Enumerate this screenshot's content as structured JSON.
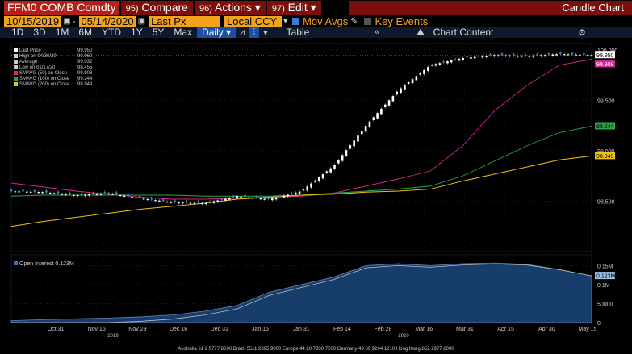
{
  "topbar": {
    "ticker": "FFM0 COMB Comdty",
    "compare_num": "95)",
    "compare": "Compare",
    "actions_num": "96)",
    "actions": "Actions ▾",
    "edit_num": "97)",
    "edit": "Edit ▾",
    "title": "Candle Chart"
  },
  "controls": {
    "start_date": "10/15/2019",
    "end_date": "05/14/2020",
    "field": "Last Px",
    "currency": "Local CCY",
    "mov_avgs": "Mov Avgs",
    "key_events": "Key Events"
  },
  "toolbar": {
    "periods": [
      "1D",
      "3D",
      "1M",
      "6M",
      "YTD",
      "1Y",
      "5Y",
      "Max"
    ],
    "frequency": "Daily ▾",
    "table": "Table",
    "chart_content": "Chart Content"
  },
  "legend": [
    {
      "label": "Last Price",
      "value": "99.950",
      "color": "#ffffff"
    },
    {
      "label": "High on 04/30/20",
      "value": "99.960",
      "color": "#cccccc"
    },
    {
      "label": "Average",
      "value": "99.032",
      "color": "#cccccc"
    },
    {
      "label": "Low on 01/17/20",
      "value": "98.455",
      "color": "#cccccc"
    },
    {
      "label": "SMAVG (50)  on Close",
      "value": "99.908",
      "color": "#d3248f"
    },
    {
      "label": "SMAVG (100)  on Close",
      "value": "99.244",
      "color": "#27a844"
    },
    {
      "label": "SMAVG (200)  on Close",
      "value": "98.949",
      "color": "#f1c40f"
    }
  ],
  "oi_legend": "Open Interest  0.123M",
  "price_axis": {
    "ticks": [
      "100.000",
      "99.500",
      "99.000",
      "98.500"
    ],
    "labels": [
      {
        "text": "99.950",
        "bg": "#ffffff",
        "fg": "#000000"
      },
      {
        "text": "99.908",
        "bg": "#d3248f",
        "fg": "#ffffff"
      },
      {
        "text": "99.244",
        "bg": "#27a844",
        "fg": "#000000"
      },
      {
        "text": "98.949",
        "bg": "#f1c40f",
        "fg": "#000000"
      }
    ]
  },
  "oi_axis": {
    "ticks": [
      "0.15M",
      "0.1M",
      "50000",
      "0"
    ],
    "label": "0.123M"
  },
  "x_axis": {
    "ticks": [
      "Oct 31",
      "Nov 15",
      "Nov 29",
      "Dec 16",
      "Dec 31",
      "Jan 15",
      "Jan 31",
      "Feb 14",
      "Feb 28",
      "Mar 16",
      "Mar 31",
      "Apr 15",
      "Apr 30",
      "May 15"
    ],
    "years": [
      "2019",
      "2020"
    ]
  },
  "footer": "Australia 61 2 9777 8600  Brazil 5511 2395 9000  Europe 44 20 7330 7500  Germany 49 69 9204 1210  Hong Kong 852 2977 6000",
  "chart_data": {
    "type": "candlestick",
    "price": {
      "x": [
        "Oct 15",
        "Oct 31",
        "Nov 15",
        "Nov 29",
        "Dec 16",
        "Dec 31",
        "Jan 15",
        "Jan 31",
        "Feb 14",
        "Feb 21",
        "Feb 28",
        "Mar 3",
        "Mar 6",
        "Mar 9",
        "Mar 16",
        "Mar 31",
        "Apr 15",
        "Apr 30",
        "May 14"
      ],
      "close": [
        98.6,
        98.59,
        98.56,
        98.58,
        98.53,
        98.49,
        98.48,
        98.55,
        98.52,
        98.6,
        98.85,
        99.25,
        99.6,
        99.85,
        99.92,
        99.95,
        99.94,
        99.96,
        99.95
      ],
      "ylim": [
        98.0,
        100.0
      ]
    },
    "series": [
      {
        "name": "SMAVG (50)",
        "values": [
          98.68,
          98.64,
          98.6,
          98.57,
          98.54,
          98.52,
          98.52,
          98.53,
          98.54,
          98.55,
          98.58,
          98.65,
          98.72,
          98.8,
          99.05,
          99.4,
          99.65,
          99.85,
          99.908
        ]
      },
      {
        "name": "SMAVG (100)",
        "values": [
          98.55,
          98.56,
          98.56,
          98.56,
          98.56,
          98.56,
          98.55,
          98.55,
          98.55,
          98.56,
          98.58,
          98.6,
          98.62,
          98.65,
          98.75,
          98.9,
          99.05,
          99.18,
          99.244
        ]
      },
      {
        "name": "SMAVG (200)",
        "values": [
          98.25,
          98.3,
          98.34,
          98.38,
          98.42,
          98.45,
          98.48,
          98.52,
          98.54,
          98.56,
          98.57,
          98.59,
          98.6,
          98.62,
          98.7,
          98.77,
          98.84,
          98.91,
          98.949
        ]
      }
    ],
    "open_interest": {
      "name": "Open Interest",
      "values": [
        0.005,
        0.008,
        0.01,
        0.012,
        0.015,
        0.02,
        0.03,
        0.045,
        0.08,
        0.1,
        0.12,
        0.15,
        0.155,
        0.15,
        0.155,
        0.157,
        0.153,
        0.14,
        0.123
      ],
      "ylim": [
        0,
        0.17
      ]
    }
  }
}
